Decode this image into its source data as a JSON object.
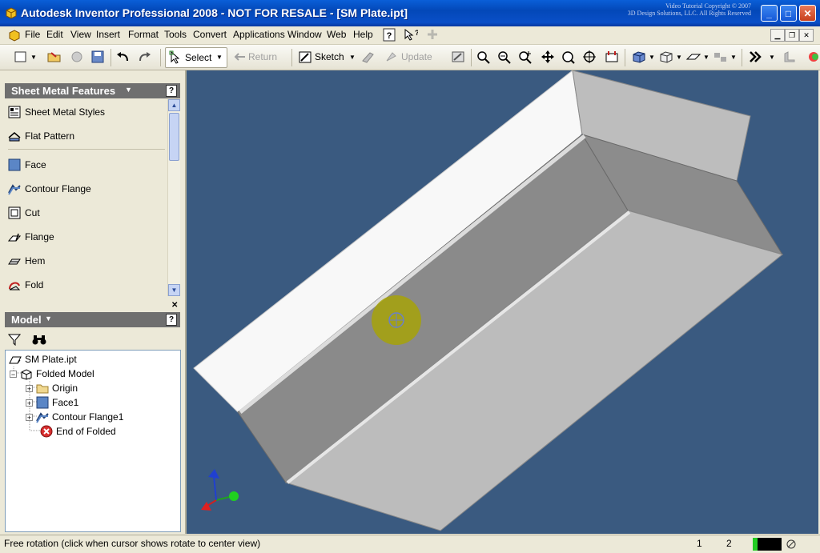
{
  "window": {
    "title": "Autodesk Inventor Professional 2008 - NOT FOR RESALE - [SM Plate.ipt]",
    "watermark_line1": "Video Tutorial Copyright © 2007",
    "watermark_line2": "3D Design Solutions, LLC. All Rights Reserved",
    "min_label": "_",
    "max_label": "□",
    "close_label": "✕"
  },
  "menu": {
    "items": [
      "File",
      "Edit",
      "View",
      "Insert",
      "Format",
      "Tools",
      "Convert",
      "Applications",
      "Window",
      "Web",
      "Help"
    ]
  },
  "toolbar": {
    "select_label": "Select",
    "return_label": "Return",
    "sketch_label": "Sketch",
    "update_label": "Update"
  },
  "features_panel": {
    "header": "Sheet Metal Features",
    "items": [
      "Sheet Metal Styles",
      "Flat Pattern",
      "Face",
      "Contour Flange",
      "Cut",
      "Flange",
      "Hem",
      "Fold"
    ]
  },
  "model_panel": {
    "header": "Model",
    "tree": {
      "root": "SM Plate.ipt",
      "folded_model": "Folded Model",
      "origin": "Origin",
      "face": "Face1",
      "contour_flange": "Contour Flange1",
      "end_of_folded": "End of Folded"
    }
  },
  "status": {
    "text": "Free rotation (click when cursor shows rotate to center view)",
    "n1": "1",
    "n2": "2"
  },
  "colors": {
    "viewport_bg": "#3a5a80",
    "panel_header": "#6f6f6f",
    "titlebar": "#0a4fc8",
    "cursor_highlight": "#b8b000"
  }
}
